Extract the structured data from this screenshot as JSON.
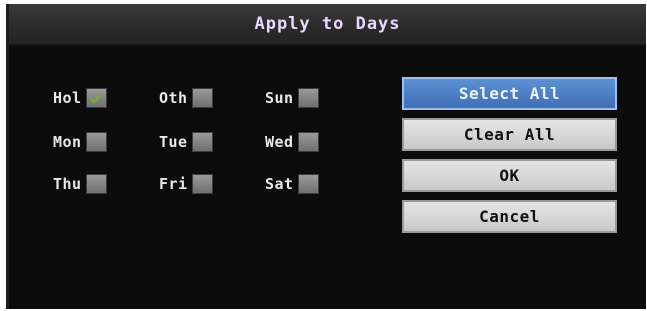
{
  "dialog": {
    "title": "Apply to Days"
  },
  "days": [
    {
      "label": "Hol",
      "checked": true
    },
    {
      "label": "Oth",
      "checked": false
    },
    {
      "label": "Sun",
      "checked": false
    },
    {
      "label": "Mon",
      "checked": false
    },
    {
      "label": "Tue",
      "checked": false
    },
    {
      "label": "Wed",
      "checked": false
    },
    {
      "label": "Thu",
      "checked": false
    },
    {
      "label": "Fri",
      "checked": false
    },
    {
      "label": "Sat",
      "checked": false
    }
  ],
  "buttons": {
    "select_all": "Select All",
    "clear_all": "Clear All",
    "ok": "OK",
    "cancel": "Cancel"
  },
  "colors": {
    "accent": "#4f80c8",
    "checkmark": "#7fa63a"
  }
}
